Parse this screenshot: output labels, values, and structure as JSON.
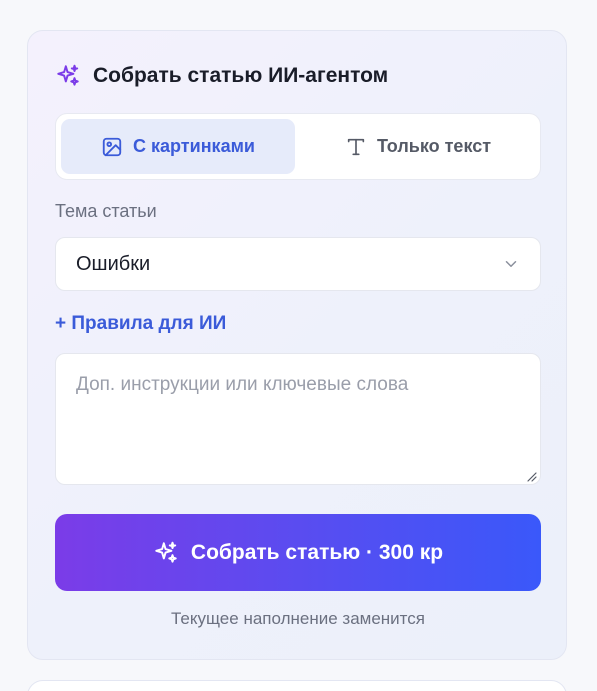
{
  "card": {
    "title": "Собрать статью ИИ-агентом",
    "title_icon": "sparkles-icon"
  },
  "mode_toggle": {
    "options": [
      {
        "label": "С картинками",
        "icon": "image-icon",
        "active": true
      },
      {
        "label": "Только текст",
        "icon": "text-icon",
        "active": false
      }
    ]
  },
  "topic": {
    "label": "Тема статьи",
    "value": "Ошибки",
    "icon": "chevron-down-icon"
  },
  "rules": {
    "link_label": "+ Правила для ИИ"
  },
  "instructions": {
    "value": "",
    "placeholder": "Доп. инструкции или ключевые слова"
  },
  "submit": {
    "label": "Собрать статью · 300 кр",
    "icon": "sparkles-icon"
  },
  "hint": "Текущее наполнение заменится",
  "colors": {
    "accent": "#3b5bd9",
    "gradient_start": "#7b3ce8",
    "gradient_end": "#3a58fa",
    "title_icon": "#7b3ce8"
  }
}
